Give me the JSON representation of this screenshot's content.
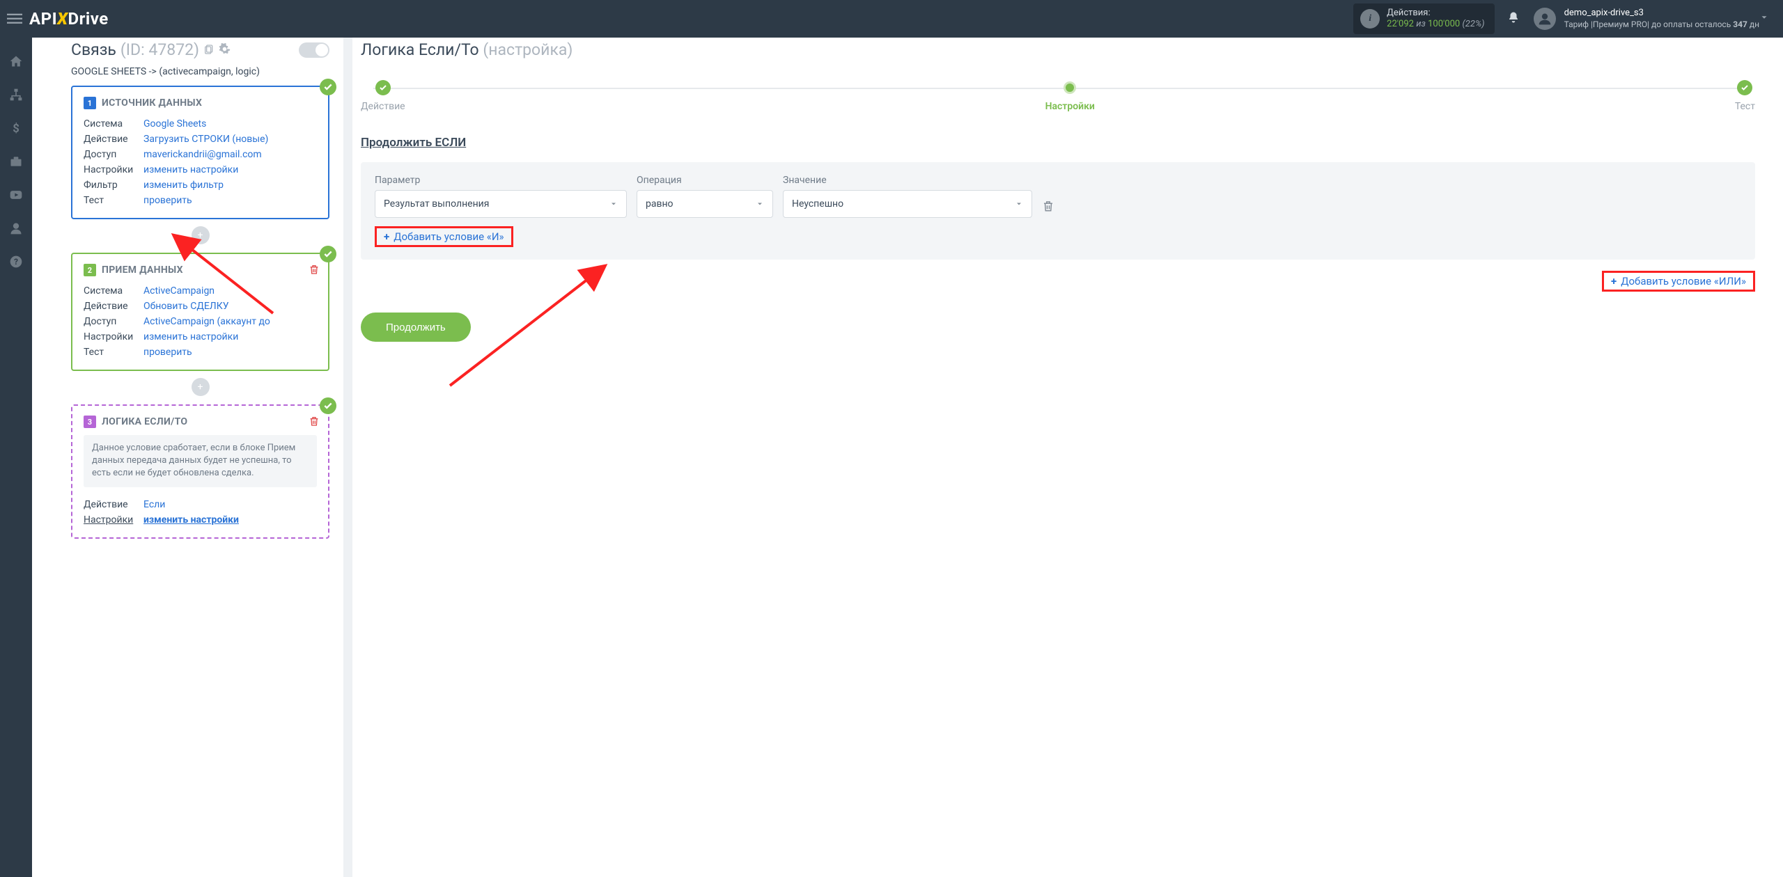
{
  "topbar": {
    "credits_label": "Действия:",
    "credits_used": "22'092",
    "credits_of": "из",
    "credits_total": "100'000",
    "credits_pct": "(22%)",
    "user_name": "demo_apix-drive_s3",
    "tariff_prefix": "Тариф |Премиум PRO|  до оплаты осталось ",
    "tariff_days": "347",
    "tariff_suffix": " дн"
  },
  "sidebar": {
    "title_label": "Связь",
    "title_id": "(ID: 47872)",
    "path": "GOOGLE SHEETS -> (activecampaign, logic)",
    "card1": {
      "title": "ИСТОЧНИК ДАННЫХ",
      "rows": {
        "k_system": "Система",
        "v_system": "Google Sheets",
        "k_action": "Действие",
        "v_action": "Загрузить СТРОКИ (новые)",
        "k_access": "Доступ",
        "v_access": "maverickandrii@gmail.com",
        "k_settings": "Настройки",
        "v_settings": "изменить настройки",
        "k_filter": "Фильтр",
        "v_filter": "изменить фильтр",
        "k_test": "Тест",
        "v_test": "проверить"
      }
    },
    "card2": {
      "title": "ПРИЕМ ДАННЫХ",
      "rows": {
        "k_system": "Система",
        "v_system": "ActiveCampaign",
        "k_action": "Действие",
        "v_action": "Обновить СДЕЛКУ",
        "k_access": "Доступ",
        "v_access": "ActiveCampaign (аккаунт до",
        "k_settings": "Настройки",
        "v_settings": "изменить настройки",
        "k_test": "Тест",
        "v_test": "проверить"
      }
    },
    "card3": {
      "title": "ЛОГИКА ЕСЛИ/ТО",
      "desc": "Данное условие сработает, если в блоке Прием данных передача данных будет не успешна, то есть если не будет обновлена сделка.",
      "rows": {
        "k_action": "Действие",
        "v_action": "Если",
        "k_settings": "Настройки",
        "v_settings": "изменить настройки"
      }
    }
  },
  "main": {
    "title": "Логика Если/То",
    "subtitle": "(настройка)",
    "steps": {
      "action": "Действие",
      "settings": "Настройки",
      "test": "Тест"
    },
    "section": "Продолжить ЕСЛИ",
    "labels": {
      "param": "Параметр",
      "op": "Операция",
      "val": "Значение"
    },
    "values": {
      "param": "Результат выполнения",
      "op": "равно",
      "val": "Неуспешно"
    },
    "add_and": "Добавить условие «И»",
    "add_or": "Добавить условие «ИЛИ»",
    "continue": "Продолжить"
  }
}
